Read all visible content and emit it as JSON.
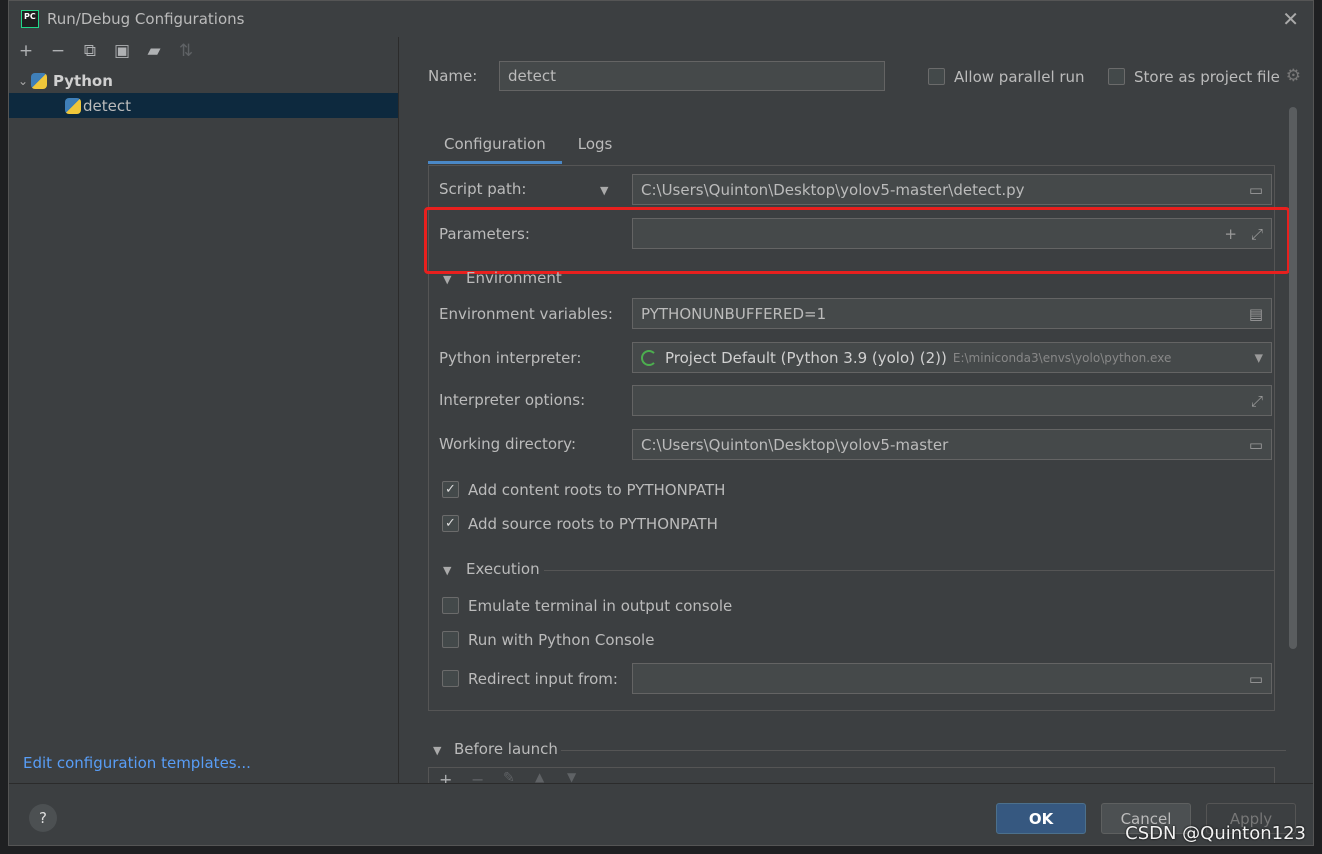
{
  "window": {
    "title": "Run/Debug Configurations",
    "app_logo": "PC"
  },
  "left": {
    "toolbar": [
      {
        "name": "add-icon",
        "glyph": "+"
      },
      {
        "name": "remove-icon",
        "glyph": "−"
      },
      {
        "name": "copy-icon",
        "glyph": "⧉"
      },
      {
        "name": "save-icon",
        "glyph": "▣"
      },
      {
        "name": "new-folder-icon",
        "glyph": "▰"
      },
      {
        "name": "sort-icon",
        "glyph": "⇅"
      }
    ],
    "tree": {
      "group_label": "Python",
      "item_label": "detect"
    },
    "edit_templates_link": "Edit configuration templates..."
  },
  "header": {
    "name_label": "Name:",
    "name_value": "detect",
    "allow_parallel_label": "Allow parallel run",
    "store_project_label": "Store as project file"
  },
  "tabs": [
    "Configuration",
    "Logs"
  ],
  "config": {
    "script_path_label": "Script path:",
    "script_path_value": "C:\\Users\\Quinton\\Desktop\\yolov5-master\\detect.py",
    "parameters_label": "Parameters:",
    "parameters_value": "",
    "environment_section": "Environment",
    "env_vars_label": "Environment variables:",
    "env_vars_value": "PYTHONUNBUFFERED=1",
    "interpreter_label": "Python interpreter:",
    "interpreter_value": "Project Default (Python 3.9 (yolo) (2))",
    "interpreter_path": "E:\\miniconda3\\envs\\yolo\\python.exe",
    "interp_options_label": "Interpreter options:",
    "interp_options_value": "",
    "working_dir_label": "Working directory:",
    "working_dir_value": "C:\\Users\\Quinton\\Desktop\\yolov5-master",
    "add_content_roots_label": "Add content roots to PYTHONPATH",
    "add_content_roots_checked": true,
    "add_source_roots_label": "Add source roots to PYTHONPATH",
    "add_source_roots_checked": true,
    "execution_section": "Execution",
    "emulate_terminal_label": "Emulate terminal in output console",
    "emulate_terminal_checked": false,
    "python_console_label": "Run with Python Console",
    "python_console_checked": false,
    "redirect_input_label": "Redirect input from:",
    "redirect_input_checked": false,
    "redirect_input_value": ""
  },
  "before_launch": {
    "label": "Before launch"
  },
  "footer": {
    "help_label": "?",
    "ok_label": "OK",
    "cancel_label": "Cancel",
    "apply_label": "Apply"
  },
  "watermark": "CSDN @Quinton123",
  "colors": {
    "accent": "#4a88c7",
    "highlight_box": "#e8201e",
    "link": "#589df6"
  }
}
